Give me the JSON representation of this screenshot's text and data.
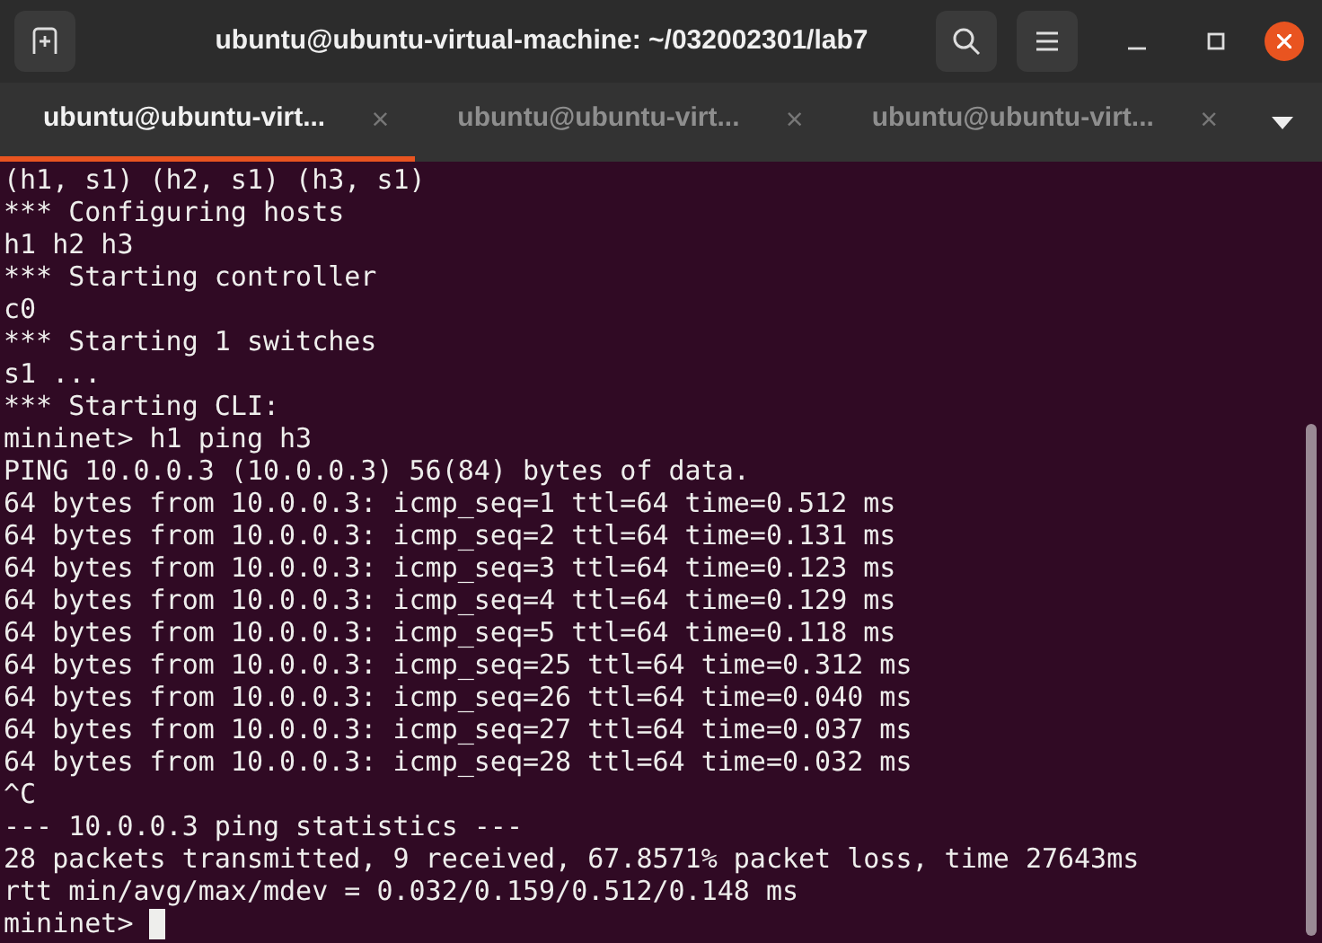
{
  "window": {
    "title": "ubuntu@ubuntu-virtual-machine: ~/032002301/lab7"
  },
  "tabs": [
    {
      "label": "ubuntu@ubuntu-virt...",
      "close": "×",
      "selected": true
    },
    {
      "label": "ubuntu@ubuntu-virt...",
      "close": "×",
      "selected": false
    },
    {
      "label": "ubuntu@ubuntu-virt...",
      "close": "×",
      "selected": false
    }
  ],
  "terminal": {
    "lines": [
      "(h1, s1) (h2, s1) (h3, s1)",
      "*** Configuring hosts",
      "h1 h2 h3",
      "*** Starting controller",
      "c0",
      "*** Starting 1 switches",
      "s1 ...",
      "*** Starting CLI:",
      "mininet> h1 ping h3",
      "PING 10.0.0.3 (10.0.0.3) 56(84) bytes of data.",
      "64 bytes from 10.0.0.3: icmp_seq=1 ttl=64 time=0.512 ms",
      "64 bytes from 10.0.0.3: icmp_seq=2 ttl=64 time=0.131 ms",
      "64 bytes from 10.0.0.3: icmp_seq=3 ttl=64 time=0.123 ms",
      "64 bytes from 10.0.0.3: icmp_seq=4 ttl=64 time=0.129 ms",
      "64 bytes from 10.0.0.3: icmp_seq=5 ttl=64 time=0.118 ms",
      "64 bytes from 10.0.0.3: icmp_seq=25 ttl=64 time=0.312 ms",
      "64 bytes from 10.0.0.3: icmp_seq=26 ttl=64 time=0.040 ms",
      "64 bytes from 10.0.0.3: icmp_seq=27 ttl=64 time=0.037 ms",
      "64 bytes from 10.0.0.3: icmp_seq=28 ttl=64 time=0.032 ms",
      "^C",
      "--- 10.0.0.3 ping statistics ---",
      "28 packets transmitted, 9 received, 67.8571% packet loss, time 27643ms",
      "rtt min/avg/max/mdev = 0.032/0.159/0.512/0.148 ms"
    ],
    "prompt": "mininet> "
  }
}
